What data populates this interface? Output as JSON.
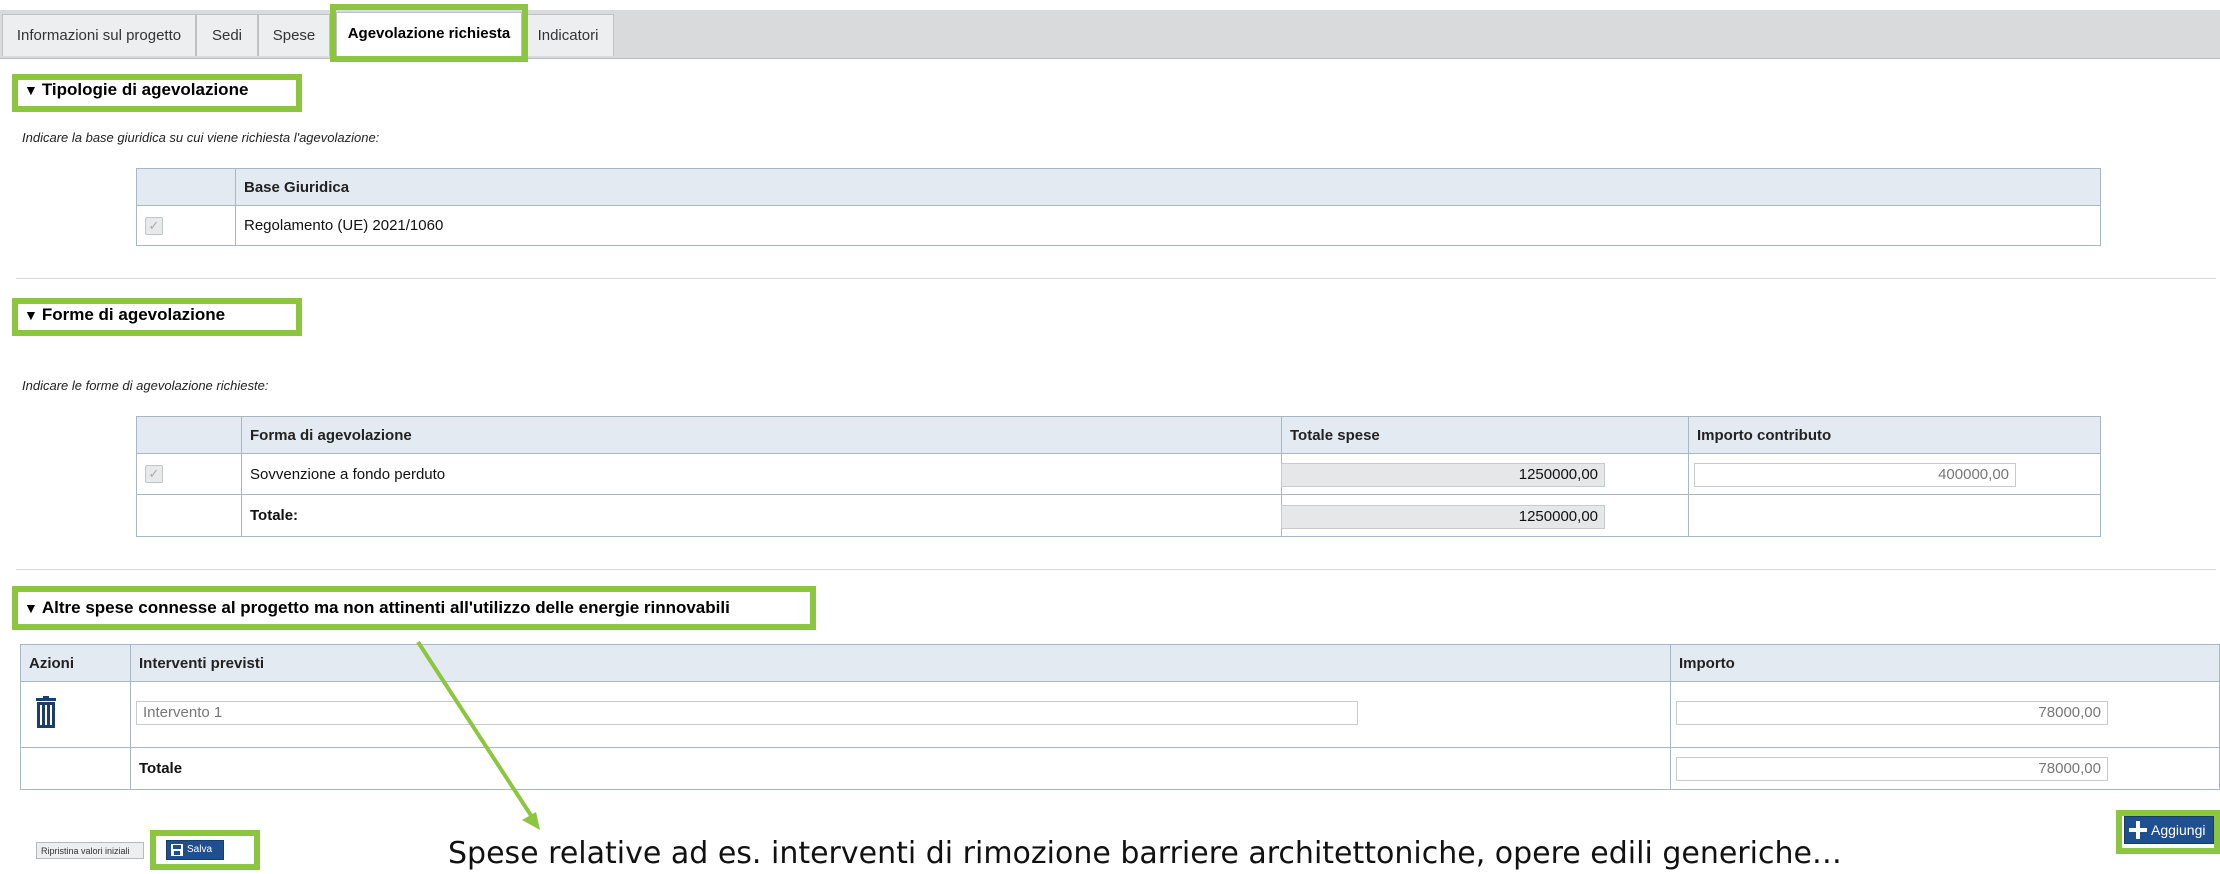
{
  "tabs": [
    {
      "label": "Informazioni sul progetto"
    },
    {
      "label": "Sedi"
    },
    {
      "label": "Spese"
    },
    {
      "label": "Agevolazione richiesta"
    },
    {
      "label": "Indicatori"
    }
  ],
  "tipologie": {
    "title": "Tipologie di agevolazione",
    "hint": "Indicare la base giuridica su cui viene richiesta l'agevolazione:",
    "columns": [
      "Base Giuridica"
    ],
    "rows": [
      {
        "checked": true,
        "base": "Regolamento (UE) 2021/1060"
      }
    ]
  },
  "forme": {
    "title": "Forme di agevolazione",
    "hint": "Indicare le forme di agevolazione richieste:",
    "columns": [
      "Forma di agevolazione",
      "Totale spese",
      "Importo contributo"
    ],
    "rows": [
      {
        "checked": true,
        "forma": "Sovvenzione a fondo perduto",
        "totale_spese": "1250000,00",
        "importo": "400000,00"
      }
    ],
    "total_label": "Totale:",
    "total_spese": "1250000,00"
  },
  "altre": {
    "title": "Altre spese connesse al progetto ma non attinenti all'utilizzo delle energie rinnovabili",
    "columns": [
      "Azioni",
      "Interventi previsti",
      "Importo"
    ],
    "rows": [
      {
        "intervento": "Intervento 1",
        "importo": "78000,00",
        "action_icon": "trash-icon"
      }
    ],
    "total_label": "Totale",
    "total_importo": "78000,00"
  },
  "buttons": {
    "reset": "Ripristina valori iniziali",
    "save": "Salva",
    "add": "Aggiungi"
  },
  "annotation": "Spese relative ad es. interventi di rimozione barriere architettoniche, opere edili generiche…",
  "colors": {
    "highlight": "#8cc53f",
    "header_bg": "#e4eaf1",
    "button_blue": "#1f4f8f"
  }
}
